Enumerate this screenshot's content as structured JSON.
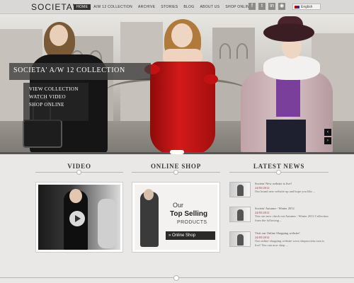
{
  "brand": {
    "logo": "SOCIETA'"
  },
  "nav": {
    "items": [
      "HOME",
      "A/W 12 COLLECTION",
      "ARCHIVE",
      "STORIES",
      "BLOG",
      "ABOUT US",
      "SHOP ONLINE"
    ],
    "active_index": 0
  },
  "social": {
    "icons": [
      "facebook-icon",
      "twitter-icon",
      "linkedin-icon",
      "rss-icon"
    ],
    "glyphs": [
      "f",
      "t",
      "in",
      "◉"
    ]
  },
  "language": {
    "label": "English"
  },
  "hero": {
    "caption": "SOCIETA' A/W 12 COLLECTION",
    "links": [
      "VIEW COLLECTION",
      "WATCH VIDEO",
      "SHOP ONLINE"
    ],
    "arrow_prev": "‹",
    "arrow_next": "›"
  },
  "sections": {
    "video": "VIDEO",
    "shop": "ONLINE SHOP",
    "news": "LATEST NEWS"
  },
  "shop_promo": {
    "line1": "Our",
    "line2": "Top Selling",
    "line3": "PRODUCTS",
    "button": "» Online Shop"
  },
  "news": [
    {
      "title": "Societa' New website is live!",
      "date": "24/05/2012",
      "text": "Our brand new website up and hope you like ..."
    },
    {
      "title": "Societa' Autumn - Winter 2012",
      "date": "24/05/2012",
      "text": "You can now check out Autumn - Winter 2012 Collection from the following ..."
    },
    {
      "title": "Visit our Online Shopping website!",
      "date": "24/05/2012",
      "text": "Our online-shopping website www.shopsocieta.com is live! You can now shop ..."
    }
  ],
  "colors": {
    "background": "#e9e8e6",
    "accent_dress": "#c41212",
    "nav_active": "#333333"
  }
}
